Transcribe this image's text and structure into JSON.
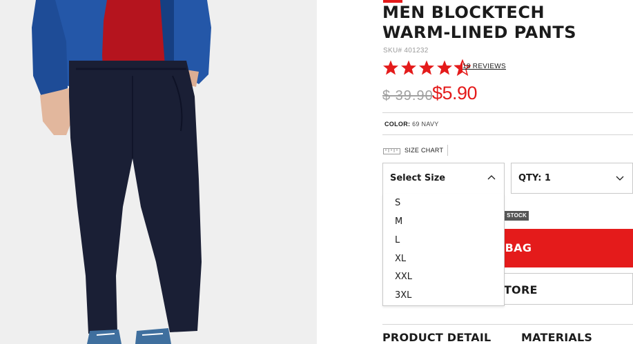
{
  "product": {
    "title": "MEN BLOCKTECH WARM-LINED PANTS",
    "sku": "SKU# 401232",
    "rating": 4.5,
    "reviews_label": "18 REVIEWS",
    "price_old": "$ 39.90",
    "price_new": "$5.90",
    "color_label": "COLOR:",
    "color_value": "69 NAVY",
    "accent_color": "#e41b1b"
  },
  "size_chart": {
    "label": "SIZE CHART",
    "icon": "ruler-icon"
  },
  "size_select": {
    "label": "Select Size",
    "options": [
      "S",
      "M",
      "L",
      "XL",
      "XXL",
      "3XL"
    ]
  },
  "qty_select": {
    "label": "QTY: 1"
  },
  "stock_badge": "F STOCK",
  "buttons": {
    "add_to_bag": "TO BAG",
    "find_in_store": "IN STORE"
  },
  "tabs": {
    "product_detail": "PRODUCT DETAIL",
    "materials": "MATERIALS"
  }
}
